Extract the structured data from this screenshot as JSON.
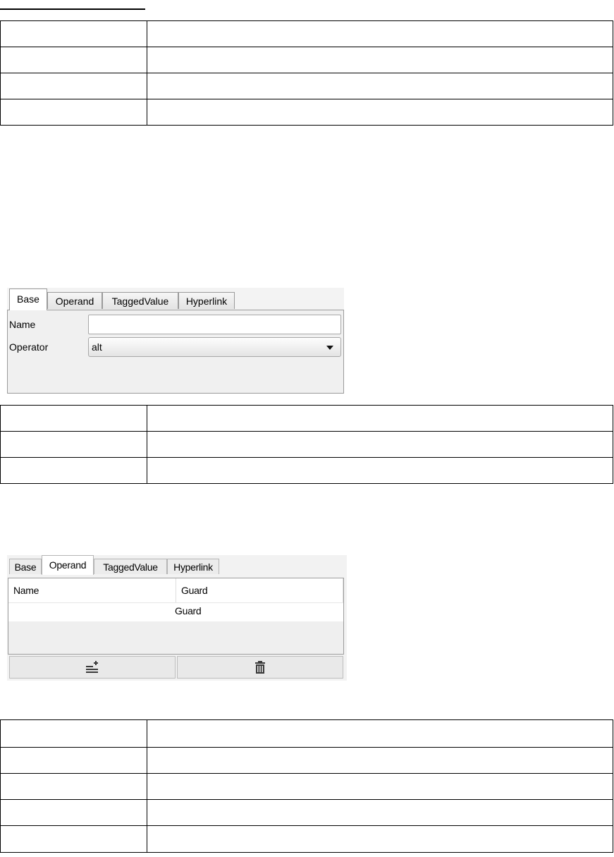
{
  "table1": {
    "rows": [
      [
        "",
        ""
      ],
      [
        "",
        ""
      ],
      [
        "",
        ""
      ],
      [
        "",
        ""
      ]
    ]
  },
  "panel1": {
    "tabs": [
      {
        "label": "Base",
        "active": true
      },
      {
        "label": "Operand",
        "active": false
      },
      {
        "label": "TaggedValue",
        "active": false
      },
      {
        "label": "Hyperlink",
        "active": false
      }
    ],
    "name_label": "Name",
    "name_value": "",
    "operator_label": "Operator",
    "operator_value": "alt"
  },
  "table2": {
    "rows": [
      [
        "",
        ""
      ],
      [
        "",
        ""
      ],
      [
        "",
        ""
      ]
    ]
  },
  "panel2": {
    "tabs": [
      {
        "label": "Base",
        "active": false
      },
      {
        "label": "Operand",
        "active": true
      },
      {
        "label": "TaggedValue",
        "active": false
      },
      {
        "label": "Hyperlink",
        "active": false
      }
    ],
    "columns": [
      "Name",
      "Guard"
    ],
    "rows": [
      [
        "",
        "Guard"
      ]
    ],
    "add_button_icon": "add-list-icon",
    "delete_button_icon": "trash-icon"
  },
  "table3": {
    "rows": [
      [
        "",
        ""
      ],
      [
        "",
        ""
      ],
      [
        "",
        ""
      ],
      [
        "",
        ""
      ],
      [
        "",
        ""
      ]
    ]
  }
}
